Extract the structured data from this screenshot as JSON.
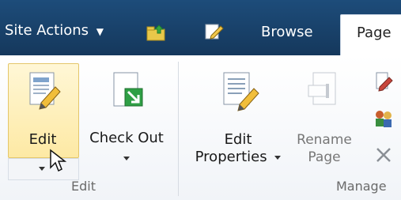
{
  "topbar": {
    "site_actions": "Site Actions",
    "browse": "Browse",
    "page": "Page"
  },
  "ribbon": {
    "edit_group": {
      "edit_button": "Edit",
      "checkout_button_line1": "Check Out",
      "group_label": "Edit"
    },
    "manage_group": {
      "edit_properties_line1": "Edit",
      "edit_properties_line2": "Properties",
      "rename_page_line1": "Rename",
      "rename_page_line2": "Page",
      "group_label": "Manage"
    }
  },
  "icons": {
    "upload": "folder-upload-icon",
    "edit_small": "edit-small-icon",
    "edit_page": "edit-page-icon",
    "check_out": "check-out-icon",
    "edit_properties": "edit-properties-icon",
    "rename": "rename-page-icon",
    "delete": "delete-x-icon",
    "side_edit": "side-edit-icon",
    "side_people": "people-icon"
  },
  "colors": {
    "topbar": "#1d4c7a",
    "highlight": "#fde9a4",
    "highlight_border": "#e4c66a"
  }
}
